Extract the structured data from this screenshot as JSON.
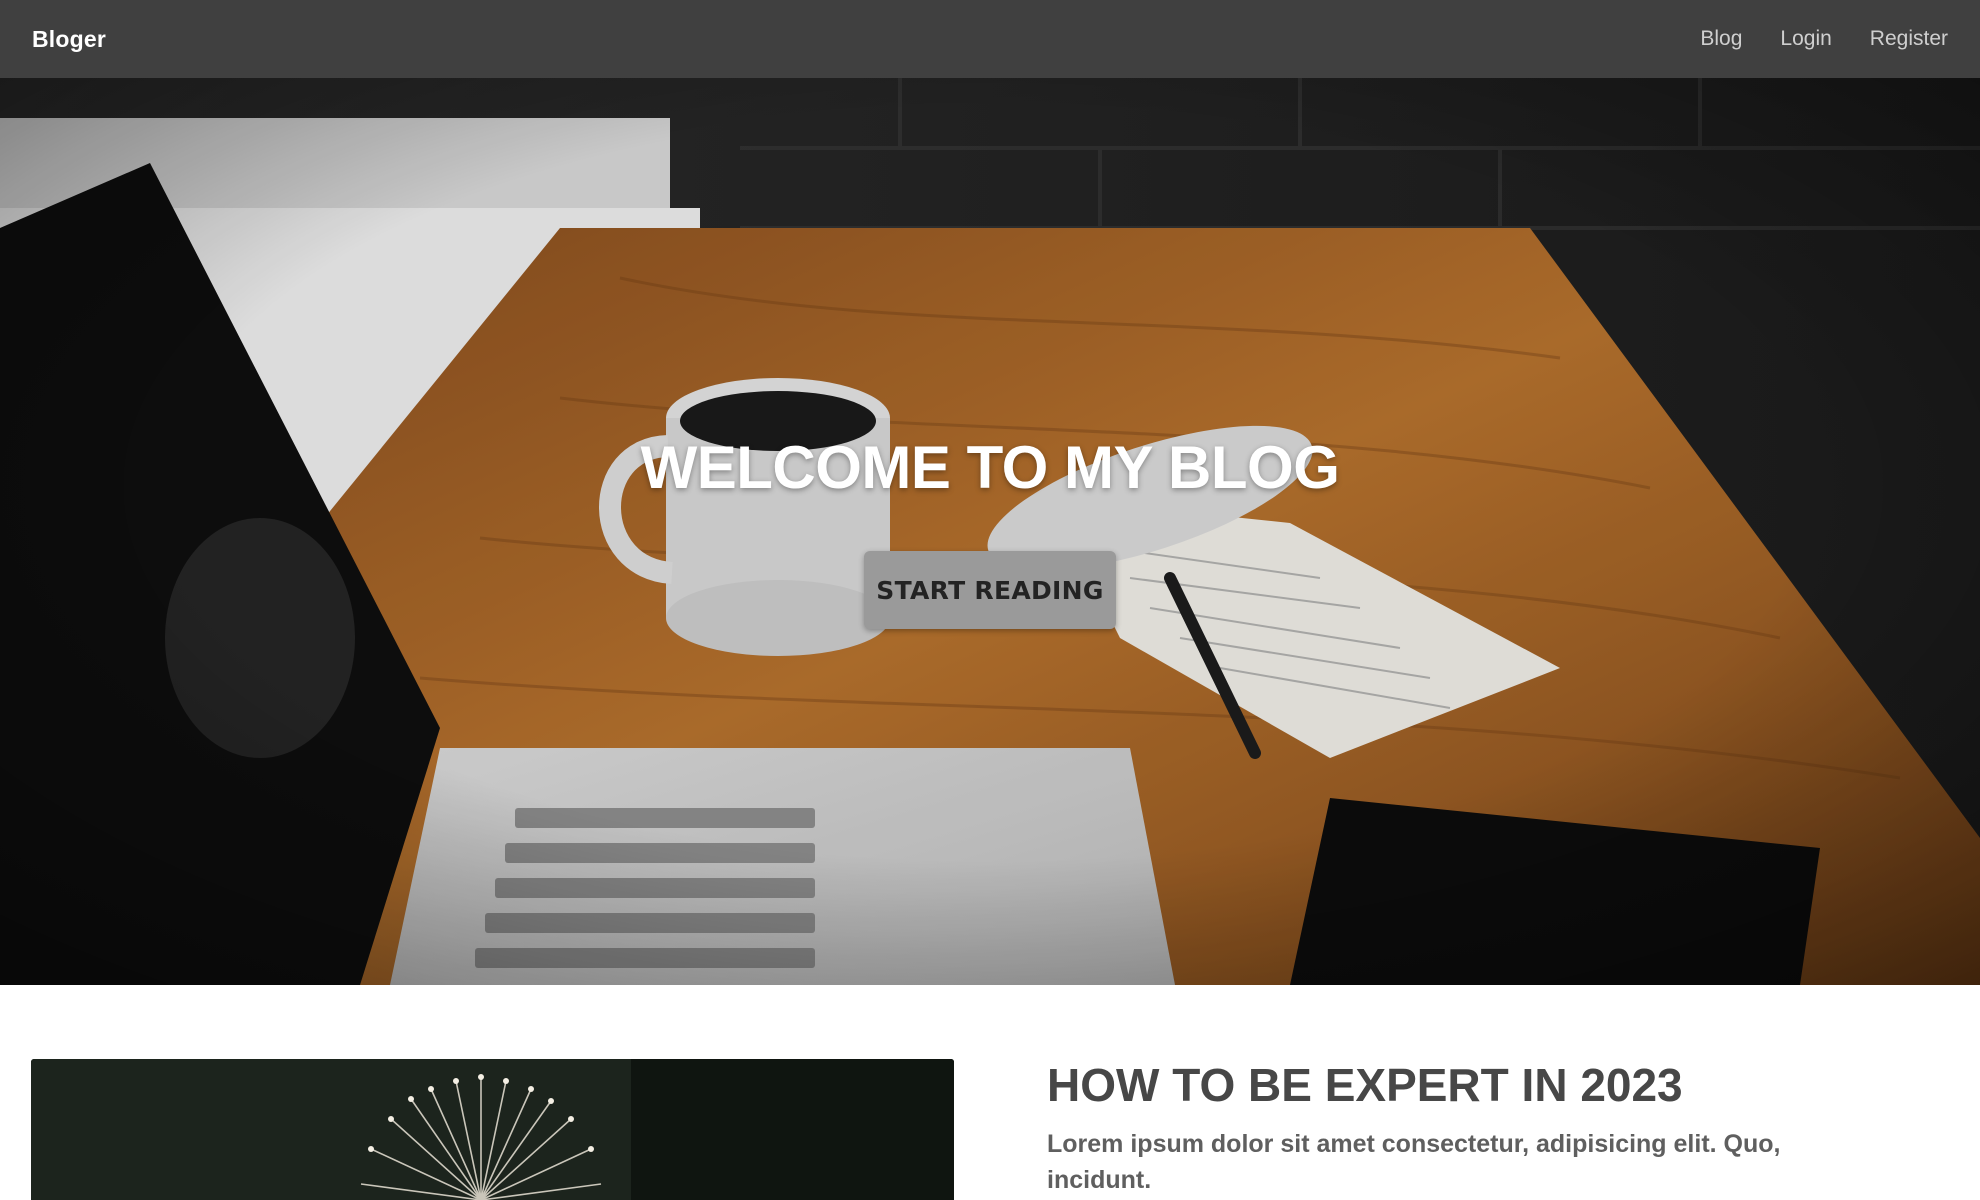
{
  "navbar": {
    "brand": "Bloger",
    "links": [
      {
        "label": "Blog"
      },
      {
        "label": "Login"
      },
      {
        "label": "Register"
      }
    ],
    "background": "#404040"
  },
  "hero": {
    "title": "WELCOME TO MY BLOG",
    "button_label": "START READING",
    "image_icon": "desk-laptop-coffee-photo"
  },
  "post": {
    "title": "HOW TO BE EXPERT IN 2023",
    "excerpt": "Lorem ipsum dolor sit amet consectetur, adipisicing elit. Quo, incidunt.",
    "image_icon": "dandelion-photo"
  },
  "colors": {
    "navbar_bg": "#404040",
    "button_bg": "#9a9a9a",
    "title_text": "#474747"
  }
}
